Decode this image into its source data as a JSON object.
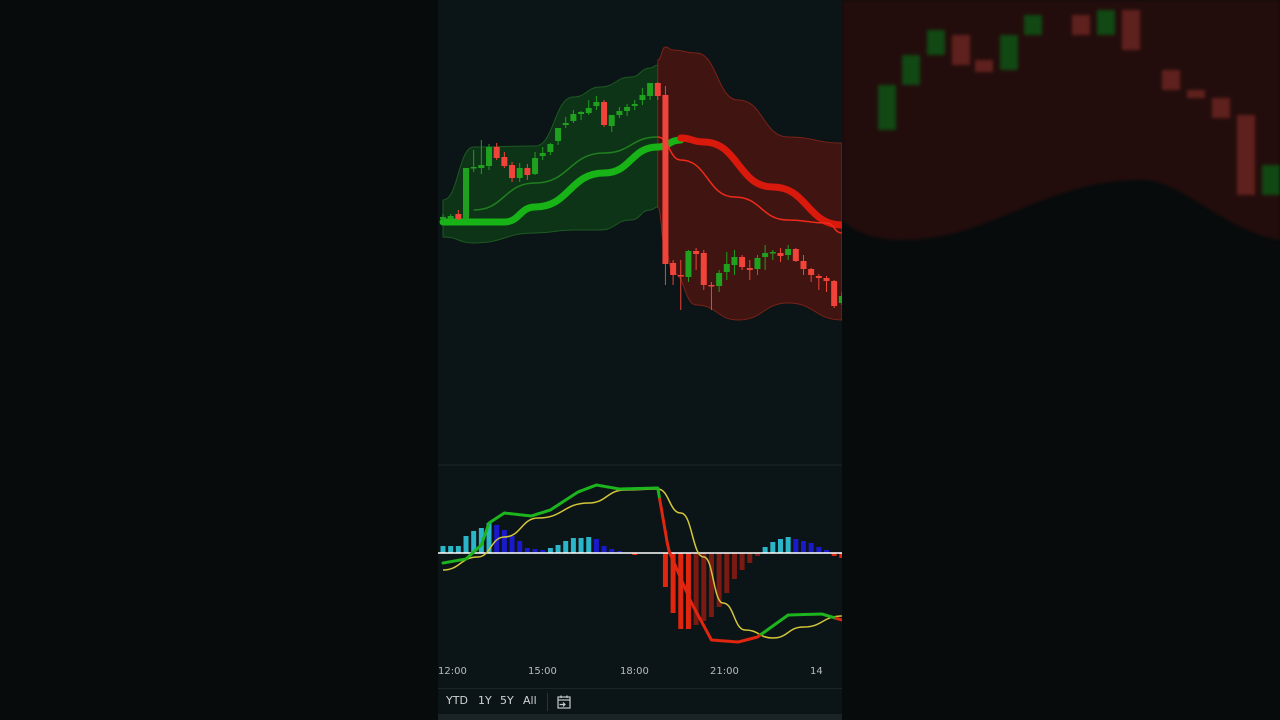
{
  "colors": {
    "up": "#1fa01f",
    "down": "#f0433a",
    "green_band": "#0f3a17",
    "red_band": "#4a1410",
    "macd_up": "#1db51d",
    "macd_down": "#e0260f",
    "signal": "#d4c63a",
    "hist_pos_rise": "#2bb5c9",
    "hist_pos_fall": "#1a1acc",
    "hist_neg_rise": "#e0260f",
    "hist_neg_fall": "#7a1a12",
    "zero_line": "#ffffff"
  },
  "time_axis": [
    "12:00",
    "15:00",
    "18:00",
    "21:00",
    "14"
  ],
  "toolbar": {
    "ytd": "YTD",
    "y1": "1Y",
    "y5": "5Y",
    "all": "All",
    "calendar_icon": "calendar-goto-icon"
  },
  "chart_data": [
    {
      "type": "candlestick",
      "title": "",
      "x": "bar index (time)",
      "candles": [
        [
          181,
          186,
          178,
          183
        ],
        [
          181,
          186,
          180,
          184
        ],
        [
          186,
          190,
          180,
          181
        ],
        [
          181,
          232,
          180,
          232
        ],
        [
          232,
          250,
          228,
          233
        ],
        [
          232,
          260,
          226,
          235
        ],
        [
          234,
          256,
          230,
          253
        ],
        [
          253,
          257,
          240,
          242
        ],
        [
          243,
          248,
          232,
          234
        ],
        [
          235,
          238,
          218,
          222
        ],
        [
          222,
          237,
          218,
          232
        ],
        [
          232,
          236,
          220,
          225
        ],
        [
          226,
          248,
          225,
          242
        ],
        [
          244,
          253,
          240,
          247
        ],
        [
          248,
          257,
          245,
          256
        ],
        [
          259,
          272,
          255,
          272
        ],
        [
          275,
          283,
          272,
          277
        ],
        [
          279,
          290,
          277,
          286
        ],
        [
          286,
          289,
          280,
          288
        ],
        [
          287,
          300,
          285,
          292
        ],
        [
          294,
          304,
          290,
          298
        ],
        [
          298,
          300,
          273,
          275
        ],
        [
          274,
          285,
          268,
          285
        ],
        [
          285,
          293,
          282,
          289
        ],
        [
          289,
          296,
          284,
          293
        ],
        [
          294,
          300,
          290,
          296
        ],
        [
          300,
          312,
          295,
          305
        ],
        [
          304,
          317,
          300,
          317
        ],
        [
          317,
          318,
          300,
          304
        ],
        [
          305,
          314,
          115,
          136
        ],
        [
          137,
          140,
          115,
          125
        ],
        [
          125,
          140,
          90,
          124
        ],
        [
          123,
          150,
          118,
          149
        ],
        [
          149,
          152,
          130,
          146
        ],
        [
          147,
          150,
          110,
          115
        ],
        [
          115,
          118,
          90,
          114
        ],
        [
          114,
          130,
          108,
          127
        ],
        [
          128,
          148,
          120,
          136
        ],
        [
          135,
          150,
          125,
          143
        ],
        [
          143,
          145,
          130,
          133
        ],
        [
          132,
          140,
          120,
          130
        ],
        [
          131,
          145,
          125,
          142
        ],
        [
          143,
          155,
          130,
          147
        ],
        [
          148,
          150,
          140,
          148
        ],
        [
          147,
          152,
          138,
          144
        ],
        [
          145,
          155,
          140,
          151
        ],
        [
          151,
          152,
          138,
          139
        ],
        [
          139,
          145,
          125,
          131
        ],
        [
          131,
          132,
          118,
          125
        ],
        [
          124,
          126,
          110,
          122
        ],
        [
          122,
          124,
          108,
          119
        ],
        [
          119,
          120,
          92,
          94
        ],
        [
          97,
          108,
          95,
          104
        ]
      ],
      "candle_format": "open,high,low,close",
      "bands": {
        "green": [
          [
            0,
            200,
            163
          ],
          [
            4,
            253,
            157
          ],
          [
            12,
            254,
            167
          ],
          [
            17,
            303,
            170
          ],
          [
            20.5,
            313,
            170
          ],
          [
            24.5,
            323,
            180
          ],
          [
            27,
            332,
            190
          ],
          [
            28,
            335,
            193
          ]
        ],
        "red": [
          [
            28,
            340,
            193
          ],
          [
            29,
            353,
            150
          ],
          [
            30,
            350,
            127
          ],
          [
            33,
            347,
            95
          ],
          [
            38.5,
            300,
            80
          ],
          [
            45,
            263,
            97
          ],
          [
            52,
            257,
            80
          ]
        ]
      },
      "ma_thick": {
        "green": [
          [
            0,
            178
          ],
          [
            8,
            178
          ],
          [
            12,
            193
          ],
          [
            21,
            227
          ],
          [
            28,
            253
          ],
          [
            31,
            260
          ]
        ],
        "red": [
          [
            31,
            262
          ],
          [
            34,
            258
          ],
          [
            43,
            213
          ],
          [
            52,
            175
          ]
        ]
      },
      "ma_thin": {
        "green": [
          [
            4,
            190
          ],
          [
            12,
            217
          ],
          [
            21,
            247
          ],
          [
            28,
            263
          ]
        ],
        "red": [
          [
            28,
            263
          ],
          [
            31,
            240
          ],
          [
            38,
            203
          ],
          [
            45,
            180
          ],
          [
            50,
            177
          ],
          [
            52,
            167
          ]
        ]
      }
    },
    {
      "type": "macd",
      "histogram": [
        7,
        7,
        7,
        17,
        22,
        25,
        30,
        28,
        23,
        17,
        12,
        5,
        4,
        3,
        5,
        8,
        12,
        15,
        15,
        16,
        14,
        7,
        4,
        2,
        0,
        -2,
        0,
        0,
        0,
        -34,
        -60,
        -76,
        -76,
        -72,
        -68,
        -64,
        -54,
        -40,
        -26,
        -17,
        -10,
        -3,
        6,
        11,
        14,
        16,
        14,
        12,
        10,
        6,
        3,
        -3,
        -5
      ],
      "macd": [
        [
          0,
          -10
        ],
        [
          3,
          -6
        ],
        [
          5,
          8
        ],
        [
          6,
          30
        ],
        [
          8,
          40
        ],
        [
          11.5,
          37
        ],
        [
          14,
          43
        ],
        [
          17.6,
          61
        ],
        [
          20,
          68
        ],
        [
          23,
          64
        ],
        [
          28,
          65
        ],
        [
          29.4,
          3
        ],
        [
          32.4,
          -50
        ],
        [
          35,
          -87
        ],
        [
          38.5,
          -89
        ],
        [
          41,
          -84
        ],
        [
          45,
          -62
        ],
        [
          49.4,
          -61
        ],
        [
          52,
          -67
        ]
      ],
      "signal": [
        [
          0,
          -17
        ],
        [
          4.5,
          -4
        ],
        [
          8,
          16
        ],
        [
          12.4,
          35
        ],
        [
          19,
          50
        ],
        [
          23.7,
          63
        ],
        [
          28,
          64
        ],
        [
          31,
          40
        ],
        [
          34,
          -4
        ],
        [
          36.5,
          -50
        ],
        [
          39.4,
          -77
        ],
        [
          43,
          -85
        ],
        [
          47,
          -74
        ],
        [
          52,
          -63
        ]
      ]
    }
  ]
}
